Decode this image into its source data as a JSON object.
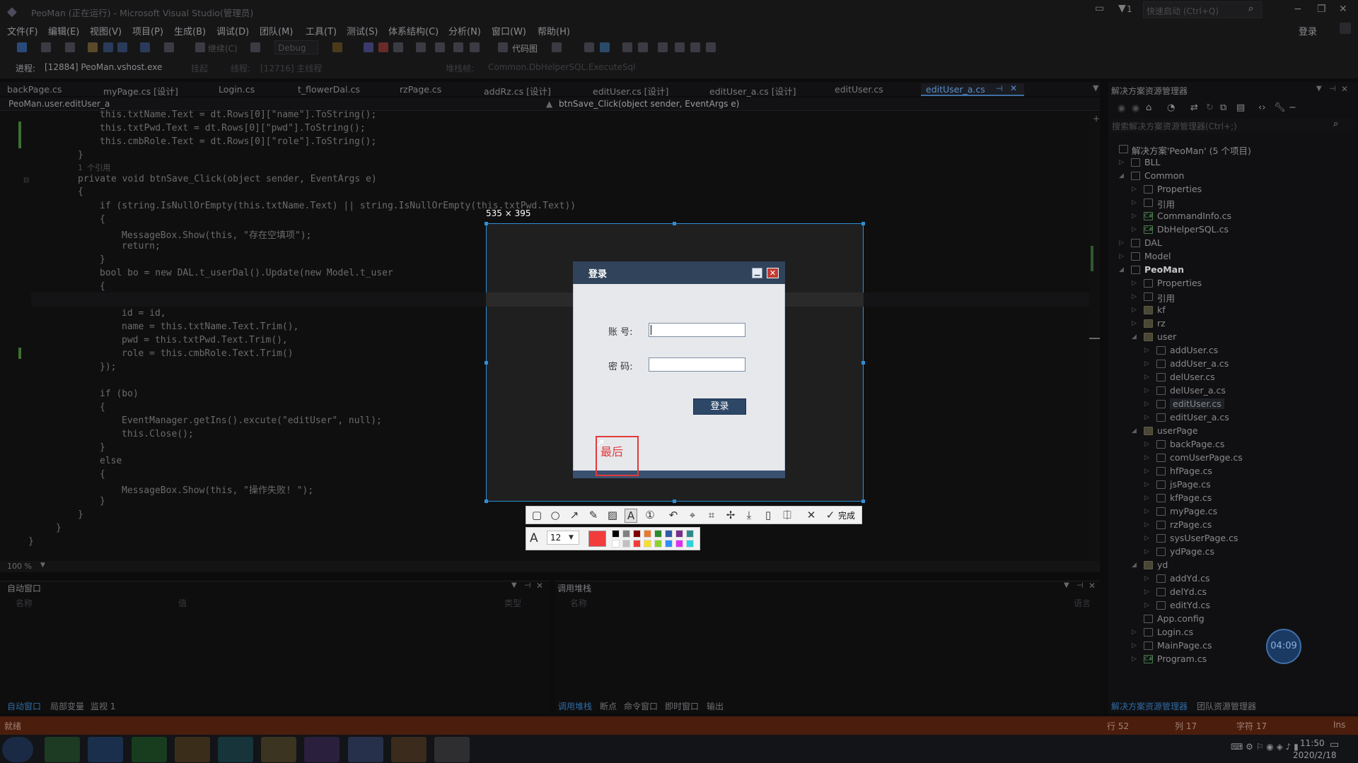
{
  "window": {
    "title": "PeoMan (正在运行) - Microsoft Visual Studio(管理员)",
    "quick_launch": "快速启动 (Ctrl+Q)",
    "notifications": "1",
    "login": "登录"
  },
  "menu": [
    "文件(F)",
    "编辑(E)",
    "视图(V)",
    "项目(P)",
    "生成(B)",
    "调试(D)",
    "团队(M)",
    "工具(T)",
    "测试(S)",
    "体系结构(C)",
    "分析(N)",
    "窗口(W)",
    "帮助(H)"
  ],
  "toolbar": {
    "continue": "继续(C)",
    "config": "Debug",
    "code_map": "代码图"
  },
  "process_bar": {
    "label": "进程:",
    "process": "[12884] PeoMan.vshost.exe",
    "suspend": "挂起",
    "thread": "线程:",
    "thread_id": "[12716] 主线程",
    "stack_frame": "堆栈帧:",
    "frame_value": "Common.DbHelperSQL.ExecuteSql"
  },
  "tabs": [
    "backPage.cs",
    "myPage.cs [设计]",
    "Login.cs",
    "t_flowerDal.cs",
    "rzPage.cs",
    "addRz.cs [设计]",
    "editUser.cs [设计]",
    "editUser_a.cs [设计]",
    "editUser.cs",
    "editUser_a.cs"
  ],
  "nav": {
    "class": "PeoMan.user.editUser_a",
    "method": "btnSave_Click(object sender, EventArgs e)"
  },
  "code": {
    "l1": "this.txtName.Text = dt.Rows[0][\"name\"].ToString();",
    "l2": "this.txtPwd.Text = dt.Rows[0][\"pwd\"].ToString();",
    "l3": "this.cmbRole.Text = dt.Rows[0][\"role\"].ToString();",
    "l4": "}",
    "l5": "1 个引用",
    "l6": "private void btnSave_Click(object sender, EventArgs e)",
    "l7": "{",
    "l8": "if (string.IsNullOrEmpty(this.txtName.Text) || string.IsNullOrEmpty(this.txtPwd.Text))",
    "l9": "{",
    "l10": "MessageBox.Show(this, \"存在空填项\");",
    "l11": "return;",
    "l12": "}",
    "l13": "bool bo = new DAL.t_userDal().Update(new Model.t_user",
    "l14": "{",
    "l15": "id = id,",
    "l16": "name = this.txtName.Text.Trim(),",
    "l17": "pwd = this.txtPwd.Text.Trim(),",
    "l18": "role = this.cmbRole.Text.Trim()",
    "l19": "});",
    "l20": "if (bo)",
    "l21": "{",
    "l22": "EventManager.getIns().excute(\"editUser\", null);",
    "l23": "this.Close();",
    "l24": "}",
    "l25": "else",
    "l26": "{",
    "l27": "MessageBox.Show(this, \"操作失败! \");",
    "l28": "}",
    "l29": "}",
    "l30": "}",
    "l31": "}"
  },
  "zoom": "100 %",
  "autos": {
    "title": "自动窗口",
    "cols": [
      "名称",
      "值",
      "类型"
    ],
    "tabs": [
      "自动窗口",
      "局部变量",
      "监视 1"
    ]
  },
  "callstack": {
    "title": "调用堆栈",
    "cols": [
      "名称",
      "语言"
    ],
    "tabs": [
      "调用堆栈",
      "断点",
      "命令窗口",
      "即时窗口",
      "输出"
    ]
  },
  "solution": {
    "title": "解决方案资源管理器",
    "search": "搜索解决方案资源管理器(Ctrl+;)",
    "root": "解决方案'PeoMan' (5 个项目)",
    "nodes": [
      "BLL",
      "Common",
      "Properties",
      "引用",
      "CommandInfo.cs",
      "DbHelperSQL.cs",
      "DAL",
      "Model",
      "PeoMan",
      "Properties",
      "引用",
      "kf",
      "rz",
      "user",
      "addUser.cs",
      "addUser_a.cs",
      "delUser.cs",
      "delUser_a.cs",
      "editUser.cs",
      "editUser_a.cs",
      "userPage",
      "backPage.cs",
      "comUserPage.cs",
      "hfPage.cs",
      "jsPage.cs",
      "kfPage.cs",
      "myPage.cs",
      "rzPage.cs",
      "sysUserPage.cs",
      "ydPage.cs",
      "yd",
      "addYd.cs",
      "delYd.cs",
      "editYd.cs",
      "App.config",
      "Login.cs",
      "MainPage.cs",
      "Program.cs"
    ],
    "tabs": [
      "解决方案资源管理器",
      "团队资源管理器"
    ]
  },
  "timer": "04:09",
  "status": {
    "state": "就绪",
    "row": "行 52",
    "col": "列 17",
    "char": "字符 17",
    "mode": "Ins"
  },
  "clock": {
    "time": "11:50",
    "date": "2020/2/18"
  },
  "capture": {
    "size": "535 × 395",
    "done": "完成",
    "font_size": "12",
    "text_value": "最后",
    "color": "#f23c3c",
    "palette": [
      "#000000",
      "#808080",
      "#800000",
      "#e67a2e",
      "#2e8a2e",
      "#2e5aa8",
      "#7a2e8a",
      "#2e8a8a",
      "#ffffff",
      "#c0c0c0",
      "#f23c3c",
      "#f5e02e",
      "#8ed12e",
      "#2e8ef5",
      "#e02ef5",
      "#2ed1e0"
    ]
  },
  "dialog": {
    "title": "登录",
    "account_label": "账  号:",
    "password_label": "密  码:",
    "account_value": "",
    "password_value": "",
    "login_button": "登录"
  }
}
